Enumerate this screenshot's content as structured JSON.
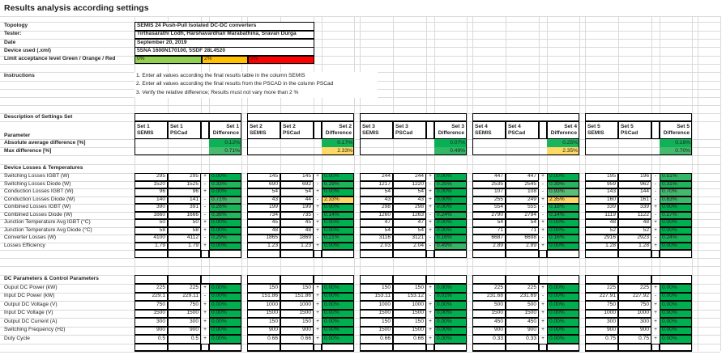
{
  "title": "Results analysis according settings",
  "info": [
    {
      "label": "Topology",
      "value": "SEMIS 24 Push-Pull Isolated DC-DC converters"
    },
    {
      "label": "Tester:",
      "value": "Tirthasarathi Lodh, Harshavardhan Marabathina, Sravan Durga"
    },
    {
      "label": "Date",
      "value": "September 20, 2019"
    },
    {
      "label": "Device used (.xml)",
      "value": "5SNA 1600N170100, 5SDF 28L4520"
    }
  ],
  "limit": {
    "label": "Limit acceptance level Green / Orange / Red",
    "levels": [
      {
        "text": "0%",
        "color": "#92d050"
      },
      {
        "text": "2%",
        "color": "#ffc000"
      },
      {
        "text": "5%",
        "color": "#ff0000"
      }
    ]
  },
  "instructions": {
    "label": "Instructions",
    "lines": [
      "1. Enter all values according the final results table in the column SEMIS",
      "2. Enter all values according the final results from the PSCAD in the column PSCad",
      "3. Verify the relative difference; Results must not vary more than 2 %"
    ]
  },
  "description_label": "Description of Settings Set",
  "parameter_label": "Parameter",
  "summary_labels": [
    "Absolute average difference  [%]",
    "Max difference [%]"
  ],
  "device_section": {
    "title": "Device Losses & Temperatures",
    "rows": [
      "Switching Losses IGBT  (W)",
      "Switching Losses Diode  (W)",
      "Conduction Losses IGBT  (W)",
      "Conduction Losses Diode  (W)",
      "Combined Losses IGBT  (W)",
      "Combined Losses Diode  (W)",
      "Junction Temperature Avg IGBT  (°C)",
      "Junction Temperature Avg Diode (°C)",
      "Converter Losses (W)",
      "Losses Efficiency"
    ]
  },
  "dc_section": {
    "title": "DC Parameters & Control Parameters",
    "rows": [
      "Ouput DC Power (kW)",
      "Input DC Power (kW)",
      "Output DC Voltage (V)",
      "Input DC Voltage (V)",
      "Output  DC Current (A)",
      "Switching Frequency (Hz)",
      "Duty Cycle"
    ]
  },
  "colors": {
    "good": "#00b050",
    "mid": "#5cbf5c",
    "warn": "#ffd966"
  },
  "sets": [
    {
      "name": "Set 1",
      "semis": "SEMIS",
      "pscad": "PSCad",
      "diff": "Difference",
      "abs_avg": "0.12%",
      "max": "0.71%",
      "device": [
        [
          "295",
          "295",
          "+",
          "0.00%"
        ],
        [
          "1520",
          "1525",
          "-",
          "0.33%"
        ],
        [
          "96",
          "96",
          "+",
          "0.00%"
        ],
        [
          "140",
          "141",
          "-",
          "0.71%"
        ],
        [
          "390",
          "391",
          "-",
          "0.26%"
        ],
        [
          "1660",
          "1666",
          "-",
          "0.36%"
        ],
        [
          "50",
          "50",
          "+",
          "0.00%"
        ],
        [
          "58",
          "58",
          "+",
          "0.00%"
        ],
        [
          "4100",
          "4112",
          "-",
          "0.29%"
        ],
        [
          "1.79",
          "1.79",
          "+",
          "0.00%"
        ]
      ],
      "dc": [
        [
          "225",
          "225",
          "+",
          "0.00%"
        ],
        [
          "229.1",
          "229.11",
          "-",
          "0.00%"
        ],
        [
          "750",
          "750",
          "+",
          "0.00%"
        ],
        [
          "1500",
          "1500",
          "+",
          "0.00%"
        ],
        [
          "300",
          "300",
          "+",
          "0.00%"
        ],
        [
          "900",
          "900",
          "+",
          "0.00%"
        ],
        [
          "0.5",
          "0.5",
          "+",
          "0.00%"
        ]
      ]
    },
    {
      "name": "Set 2",
      "semis": "SEMIS",
      "pscad": "PSCad",
      "diff": "Difference",
      "abs_avg": "0.17%",
      "max": "2.33%",
      "device": [
        [
          "145",
          "145",
          "+",
          "0.00%"
        ],
        [
          "690",
          "692",
          "-",
          "0.29%"
        ],
        [
          "54",
          "54",
          "+",
          "0.00%"
        ],
        [
          "43",
          "44",
          "-",
          "2.33%"
        ],
        [
          "199",
          "199",
          "+",
          "0.00%"
        ],
        [
          "734",
          "735",
          "-",
          "0.14%"
        ],
        [
          "45",
          "45",
          "+",
          "0.00%"
        ],
        [
          "48",
          "48",
          "+",
          "0.00%"
        ],
        [
          "1865",
          "1869",
          "-",
          "0.21%"
        ],
        [
          "1.23",
          "1.23",
          "+",
          "0.00%"
        ]
      ],
      "dc": [
        [
          "150",
          "150",
          "+",
          "0.00%"
        ],
        [
          "151.86",
          "151.86",
          "+",
          "0.00%"
        ],
        [
          "1000",
          "1000",
          "+",
          "0.00%"
        ],
        [
          "1500",
          "1500",
          "+",
          "0.00%"
        ],
        [
          "150",
          "150",
          "+",
          "0.00%"
        ],
        [
          "900",
          "900",
          "+",
          "0.00%"
        ],
        [
          "0.66",
          "0.66",
          "+",
          "0.00%"
        ]
      ]
    },
    {
      "name": "Set 3",
      "semis": "SEMIS",
      "pscad": "PSCad",
      "diff": "Difference",
      "abs_avg": "0.07%",
      "max": "0.49%",
      "device": [
        [
          "244",
          "244",
          "+",
          "0.00%"
        ],
        [
          "1217",
          "1220",
          "-",
          "0.25%"
        ],
        [
          "54",
          "54",
          "+",
          "0.00%"
        ],
        [
          "43",
          "43",
          "+",
          "0.00%"
        ],
        [
          "298",
          "298",
          "+",
          "0.00%"
        ],
        [
          "1260",
          "1263",
          "-",
          "0.24%"
        ],
        [
          "47",
          "47",
          "+",
          "0.00%"
        ],
        [
          "54",
          "54",
          "+",
          "0.00%"
        ],
        [
          "3116",
          "3121",
          "-",
          "0.16%"
        ],
        [
          "2.03",
          "2.04",
          "-",
          "0.49%"
        ]
      ],
      "dc": [
        [
          "150",
          "150",
          "+",
          "0.00%"
        ],
        [
          "153.11",
          "153.12",
          "-",
          "0.01%"
        ],
        [
          "1000",
          "1000",
          "+",
          "0.00%"
        ],
        [
          "1500",
          "1500",
          "+",
          "0.00%"
        ],
        [
          "150",
          "150",
          "+",
          "0.00%"
        ],
        [
          "1500",
          "1500",
          "+",
          "0.00%"
        ],
        [
          "0.66",
          "0.66",
          "+",
          "0.00%"
        ]
      ]
    },
    {
      "name": "Set 4",
      "semis": "SEMIS",
      "pscad": "PSCad",
      "diff": "Difference",
      "abs_avg": "0.25%",
      "max": "2.35%",
      "device": [
        [
          "447",
          "447",
          "+",
          "0.00%"
        ],
        [
          "2535",
          "2545",
          "-",
          "0.39%"
        ],
        [
          "107",
          "108",
          "-",
          "0.93%"
        ],
        [
          "255",
          "249",
          "+",
          "2.35%"
        ],
        [
          "554",
          "555",
          "-",
          "0.18%"
        ],
        [
          "2790",
          "2794",
          "-",
          "0.14%"
        ],
        [
          "54",
          "54",
          "+",
          "0.00%"
        ],
        [
          "71",
          "71",
          "+",
          "0.00%"
        ],
        [
          "6687",
          "6698",
          "-",
          "0.16%"
        ],
        [
          "2.89",
          "2.89",
          "+",
          "0.00%"
        ]
      ],
      "dc": [
        [
          "225",
          "225",
          "+",
          "0.00%"
        ],
        [
          "231.68",
          "231.69",
          "-",
          "0.00%"
        ],
        [
          "500",
          "500",
          "+",
          "0.00%"
        ],
        [
          "1500",
          "1500",
          "+",
          "0.00%"
        ],
        [
          "450",
          "450",
          "+",
          "0.00%"
        ],
        [
          "900",
          "900",
          "+",
          "0.00%"
        ],
        [
          "0.33",
          "0.33",
          "+",
          "0.00%"
        ]
      ]
    },
    {
      "name": "Set 5",
      "semis": "SEMIS",
      "pscad": "PSCad",
      "diff": "Difference",
      "abs_avg": "0.16%",
      "max": "0.70%",
      "device": [
        [
          "195",
          "196",
          "-",
          "0.51%"
        ],
        [
          "959",
          "962",
          "-",
          "0.31%"
        ],
        [
          "143",
          "144",
          "-",
          "0.70%"
        ],
        [
          "160",
          "161",
          "-",
          "0.63%"
        ],
        [
          "339",
          "339",
          "+",
          "0.00%"
        ],
        [
          "1119",
          "1122",
          "-",
          "0.27%"
        ],
        [
          "48",
          "48",
          "+",
          "0.00%"
        ],
        [
          "52",
          "52",
          "+",
          "0.00%"
        ],
        [
          "2916",
          "2923",
          "-",
          "0.24%"
        ],
        [
          "1.28",
          "1.28",
          "+",
          "0.00%"
        ]
      ],
      "dc": [
        [
          "225",
          "225",
          "+",
          "0.00%"
        ],
        [
          "227.91",
          "227.92",
          "-",
          "0.00%"
        ],
        [
          "750",
          "750",
          "+",
          "0.00%"
        ],
        [
          "1000",
          "1000",
          "+",
          "0.00%"
        ],
        [
          "300",
          "300",
          "+",
          "0.00%"
        ],
        [
          "900",
          "900",
          "+",
          "0.00%"
        ],
        [
          "0.75",
          "0.75",
          "+",
          "0.00%"
        ]
      ]
    }
  ]
}
